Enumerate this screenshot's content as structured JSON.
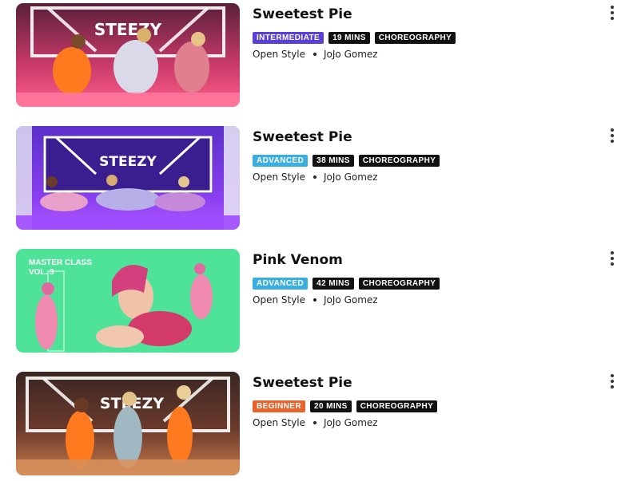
{
  "classes": [
    {
      "title": "Sweetest Pie",
      "level": "INTERMEDIATE",
      "level_color": "#5b3fd6",
      "duration": "19 MINS",
      "category": "CHOREOGRAPHY",
      "style": "Open Style",
      "instructor": "JoJo Gomez",
      "thumb_logo": "STEEZY",
      "thumb_icon": "dancers-pink-room-thumbnail"
    },
    {
      "title": "Sweetest Pie",
      "level": "ADVANCED",
      "level_color": "#3aaee0",
      "duration": "38 MINS",
      "category": "CHOREOGRAPHY",
      "style": "Open Style",
      "instructor": "JoJo Gomez",
      "thumb_logo": "STEEZY",
      "thumb_icon": "dancers-purple-room-thumbnail"
    },
    {
      "title": "Pink Venom",
      "level": "ADVANCED",
      "level_color": "#3aaee0",
      "duration": "42 MINS",
      "category": "CHOREOGRAPHY",
      "style": "Open Style",
      "instructor": "JoJo Gomez",
      "thumb_caption_line1": "MASTER CLASS",
      "thumb_caption_line2": "VOL. 3",
      "thumb_icon": "dancer-green-background-thumbnail"
    },
    {
      "title": "Sweetest Pie",
      "level": "BEGINNER",
      "level_color": "#e8632b",
      "duration": "20 MINS",
      "category": "CHOREOGRAPHY",
      "style": "Open Style",
      "instructor": "JoJo Gomez",
      "thumb_logo": "STEEZY",
      "thumb_icon": "dancers-wood-floor-thumbnail"
    }
  ]
}
